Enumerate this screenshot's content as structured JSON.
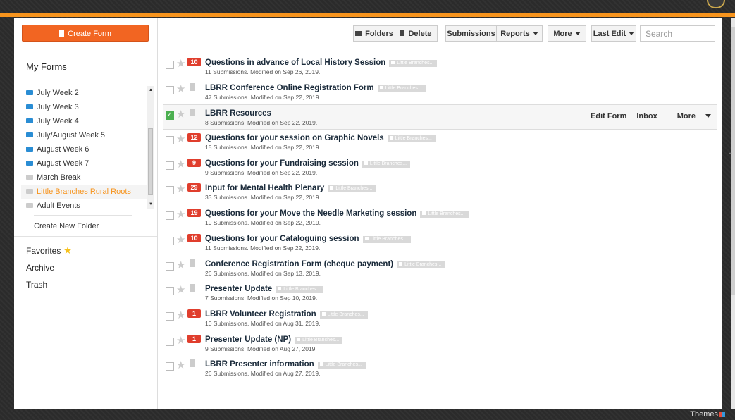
{
  "sidebar": {
    "create_form_label": "Create Form",
    "heading": "My Forms",
    "folders": [
      {
        "label": "July Week 2",
        "color": "blue",
        "active": false
      },
      {
        "label": "July Week 3",
        "color": "blue",
        "active": false
      },
      {
        "label": "July Week 4",
        "color": "blue",
        "active": false
      },
      {
        "label": "July/August Week 5",
        "color": "blue",
        "active": false
      },
      {
        "label": "August Week 6",
        "color": "blue",
        "active": false
      },
      {
        "label": "August Week 7",
        "color": "blue",
        "active": false
      },
      {
        "label": "March Break",
        "color": "grey",
        "active": false
      },
      {
        "label": "Little Branches Rural Roots",
        "color": "grey",
        "active": true
      },
      {
        "label": "Adult Events",
        "color": "grey",
        "active": false
      }
    ],
    "create_folder_label": "Create New Folder",
    "favorites_label": "Favorites",
    "archive_label": "Archive",
    "trash_label": "Trash"
  },
  "toolbar": {
    "folders_label": "Folders",
    "delete_label": "Delete",
    "submissions_label": "Submissions",
    "reports_label": "Reports",
    "more_label": "More",
    "sort_label": "Last Edit",
    "search_placeholder": "Search"
  },
  "forms": [
    {
      "title": "Questions in advance of Local History Session",
      "tag": "Little Branches...",
      "meta": "11 Submissions. Modified on Sep 26, 2019.",
      "badge": "10",
      "selected": false
    },
    {
      "title": "LBRR Conference Online Registration Form",
      "tag": "Little Branches...",
      "meta": "47 Submissions. Modified on Sep 22, 2019.",
      "badge": "",
      "selected": false
    },
    {
      "title": "LBRR Resources",
      "tag": "",
      "meta": "8 Submissions. Modified on Sep 22, 2019.",
      "badge": "",
      "selected": true
    },
    {
      "title": "Questions for your session on Graphic Novels",
      "tag": "Little Branches...",
      "meta": "15 Submissions. Modified on Sep 22, 2019.",
      "badge": "12",
      "selected": false
    },
    {
      "title": "Questions for your Fundraising session",
      "tag": "Little Branches...",
      "meta": "9 Submissions. Modified on Sep 22, 2019.",
      "badge": "9",
      "selected": false
    },
    {
      "title": "Input for Mental Health Plenary",
      "tag": "Little Branches...",
      "meta": "33 Submissions. Modified on Sep 22, 2019.",
      "badge": "29",
      "selected": false
    },
    {
      "title": "Questions for your Move the Needle Marketing session",
      "tag": "Little Branches...",
      "meta": "19 Submissions. Modified on Sep 22, 2019.",
      "badge": "19",
      "selected": false
    },
    {
      "title": "Questions for your Cataloguing session",
      "tag": "Little Branches...",
      "meta": "11 Submissions. Modified on Sep 22, 2019.",
      "badge": "10",
      "selected": false
    },
    {
      "title": "Conference Registration Form (cheque payment)",
      "tag": "Little Branches...",
      "meta": "26 Submissions. Modified on Sep 13, 2019.",
      "badge": "",
      "selected": false
    },
    {
      "title": "Presenter Update",
      "tag": "Little Branches...",
      "meta": "7 Submissions. Modified on Sep 10, 2019.",
      "badge": "",
      "selected": false
    },
    {
      "title": "LBRR Volunteer Registration",
      "tag": "Little Branches...",
      "meta": "10 Submissions. Modified on Aug 31, 2019.",
      "badge": "1",
      "selected": false
    },
    {
      "title": "Presenter Update (NP)",
      "tag": "Little Branches...",
      "meta": "9 Submissions. Modified on Aug 27, 2019.",
      "badge": "1",
      "selected": false
    },
    {
      "title": "LBRR Presenter information",
      "tag": "Little Branches...",
      "meta": "26 Submissions. Modified on Aug 27, 2019.",
      "badge": "",
      "selected": false
    }
  ],
  "row_actions": {
    "edit_form_label": "Edit Form",
    "inbox_label": "Inbox",
    "more_label": "More"
  },
  "footer": {
    "themes_label": "Themes"
  }
}
